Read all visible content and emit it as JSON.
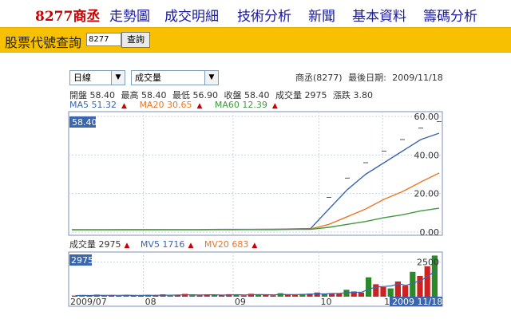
{
  "nav": {
    "brand": "8277商丞",
    "links": [
      "走勢圖",
      "成交明細",
      "技術分析",
      "新聞",
      "基本資料",
      "籌碼分析"
    ]
  },
  "search": {
    "label": "股票代號查詢",
    "input_value": "8277",
    "button": "查詢"
  },
  "controls": {
    "period": "日線",
    "indicator": "成交量"
  },
  "stock": {
    "name_code": "商丞(8277)",
    "last_date_label": "最後日期:",
    "last_date": "2009/11/18"
  },
  "quote": {
    "open": "開盤 58.40",
    "high": "最高 58.40",
    "low": "最低 56.90",
    "close": "收盤 58.40",
    "volume": "成交量 2975",
    "change": "漲跌 3.80"
  },
  "ma": {
    "ma5": "MA5 51.32",
    "ma20": "MA20 30.65",
    "ma60": "MA60 12.39"
  },
  "volume_row": {
    "vol": "成交量 2975",
    "mv5": "MV5 1716",
    "mv20": "MV20 683"
  },
  "colors": {
    "ma5": "#3a66b0",
    "ma20": "#e8782a",
    "ma60": "#3f9a3f",
    "up_bar": "#cc2222",
    "down_bar": "#2a8a2a"
  },
  "chart_data": [
    {
      "type": "line",
      "title": "",
      "yticks": [
        "0.00",
        "20.00",
        "40.00",
        "60.00"
      ],
      "ylim": [
        0,
        60
      ],
      "current_value_label": "58.40",
      "series": [
        {
          "name": "MA5",
          "color": "#3a66b0",
          "values": [
            1.2,
            1.2,
            1.2,
            1.3,
            1.3,
            1.3,
            1.3,
            1.3,
            1.4,
            1.4,
            1.4,
            1.5,
            1.6,
            1.8,
            12,
            22,
            30,
            36,
            42,
            48,
            51.32
          ]
        },
        {
          "name": "MA20",
          "color": "#e8782a",
          "values": [
            1.2,
            1.2,
            1.2,
            1.2,
            1.2,
            1.3,
            1.3,
            1.3,
            1.3,
            1.3,
            1.4,
            1.4,
            1.5,
            1.6,
            4,
            8,
            12,
            17,
            21,
            26,
            30.65
          ]
        },
        {
          "name": "MA60",
          "color": "#3f9a3f",
          "values": [
            1.2,
            1.2,
            1.2,
            1.2,
            1.2,
            1.2,
            1.2,
            1.2,
            1.3,
            1.3,
            1.3,
            1.3,
            1.4,
            1.4,
            2.5,
            4,
            5.5,
            7.5,
            9,
            11,
            12.39
          ]
        }
      ],
      "grid": true
    },
    {
      "type": "bar",
      "title": "",
      "current_value_label": "2975",
      "ytick": "2500",
      "xtick_labels": [
        "2009/07",
        "08",
        "09",
        "10",
        "11",
        "2009 11/18"
      ],
      "ylim": [
        0,
        3000
      ],
      "values": [
        80,
        120,
        60,
        150,
        90,
        110,
        70,
        130,
        100,
        60,
        140,
        90,
        170,
        80,
        120,
        200,
        110,
        90,
        160,
        130,
        100,
        180,
        140,
        90,
        210,
        120,
        150,
        100,
        250,
        160,
        130,
        190,
        220,
        300,
        180,
        260,
        240,
        500,
        380,
        300,
        1400,
        900,
        700,
        600,
        1100,
        800,
        1800,
        1500,
        2200,
        2975
      ]
    }
  ]
}
